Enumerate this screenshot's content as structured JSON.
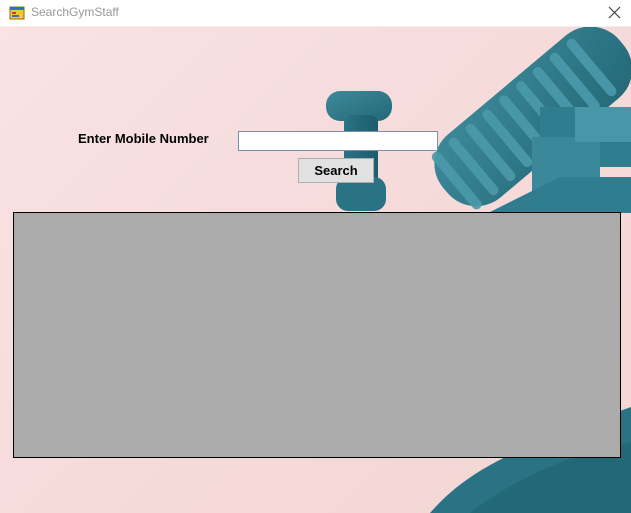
{
  "window": {
    "title": "SearchGymStaff"
  },
  "form": {
    "mobile_label": "Enter Mobile Number",
    "mobile_value": "",
    "search_label": "Search"
  },
  "icons": {
    "app": "app-form-icon",
    "close": "close-icon"
  },
  "colors": {
    "background": "#f6dcdc",
    "accent_teal": "#2f7d8f",
    "grid_background": "#ababab"
  }
}
